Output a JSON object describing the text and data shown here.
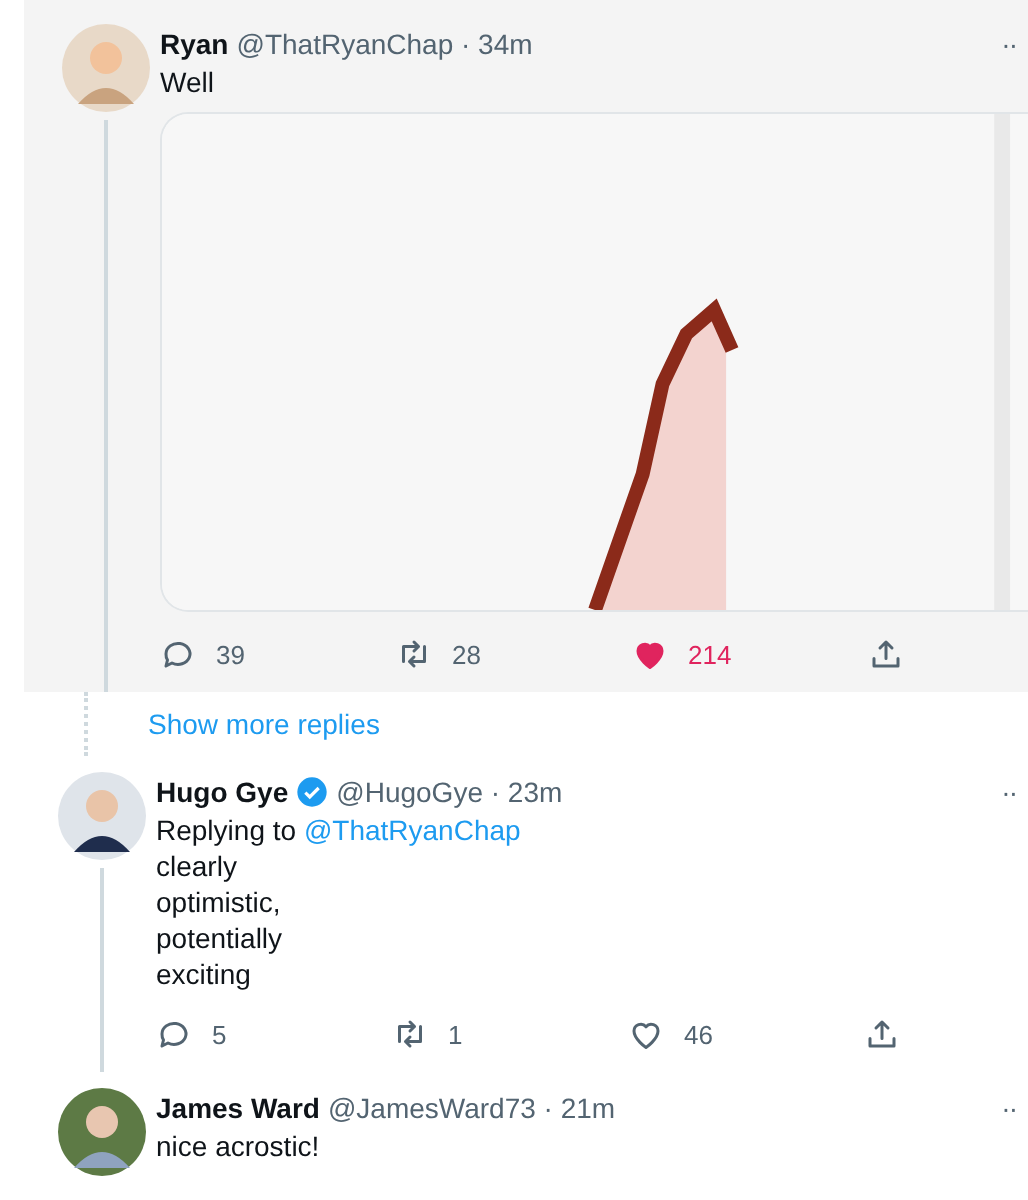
{
  "tweets": [
    {
      "kind": "focus",
      "name": "Ryan",
      "handle": "@ThatRyanChap · 34m",
      "menu": "··",
      "lines": [
        "Well"
      ],
      "media": {
        "kind": "chart-image"
      },
      "actions": {
        "replies": "39",
        "retweets": "28",
        "likes": "214",
        "liked": true
      },
      "thread_line": true
    },
    {
      "kind": "more",
      "label": "Show more replies"
    },
    {
      "kind": "reply",
      "name": "Hugo Gye",
      "verified": true,
      "handle": "@HugoGye · 23m",
      "menu": "··",
      "replying_to": "@ThatRyanChap",
      "replying_label": "Replying to",
      "lines": [
        "clearly",
        "optimistic,",
        "potentially",
        "exciting"
      ],
      "actions": {
        "replies": "5",
        "retweets": "1",
        "likes": "46",
        "liked": false
      },
      "thread_line": true
    },
    {
      "kind": "reply",
      "name": "James Ward",
      "handle": "@JamesWard73 · 21m",
      "menu": "··",
      "lines": [
        "nice acrostic!"
      ],
      "thread_line": false
    }
  ]
}
